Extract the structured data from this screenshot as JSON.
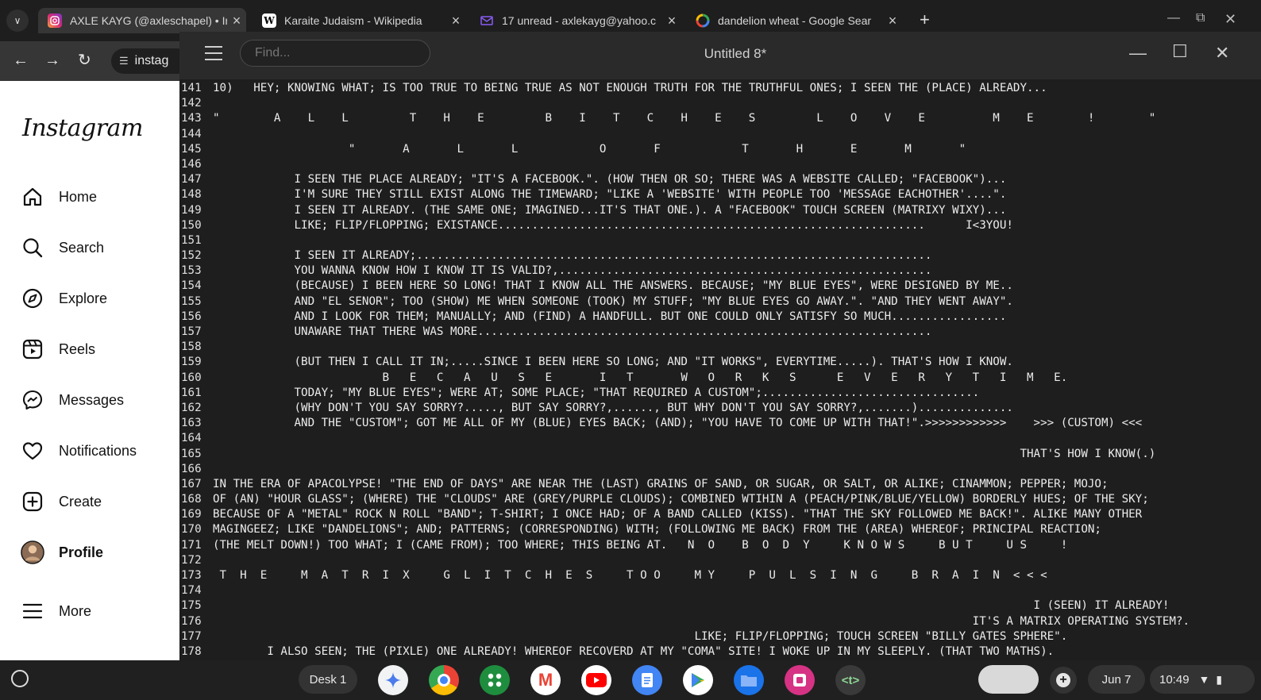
{
  "browser": {
    "tabs": [
      {
        "title": "AXLE KAYG (@axleschapel) • In",
        "icon": "instagram-icon",
        "active": true
      },
      {
        "title": "Karaite Judaism - Wikipedia",
        "icon": "wikipedia-icon",
        "active": false
      },
      {
        "title": "17 unread - axlekayg@yahoo.c",
        "icon": "mail-icon",
        "active": false
      },
      {
        "title": "dandelion wheat - Google Sear",
        "icon": "google-icon",
        "active": false
      }
    ],
    "omnibox_text": "instag"
  },
  "instagram": {
    "logo": "Instagram",
    "nav": [
      {
        "label": "Home",
        "icon": "home-icon"
      },
      {
        "label": "Search",
        "icon": "search-icon"
      },
      {
        "label": "Explore",
        "icon": "compass-icon"
      },
      {
        "label": "Reels",
        "icon": "reels-icon"
      },
      {
        "label": "Messages",
        "icon": "messenger-icon"
      },
      {
        "label": "Notifications",
        "icon": "heart-icon"
      },
      {
        "label": "Create",
        "icon": "plus-square-icon"
      },
      {
        "label": "Profile",
        "icon": "avatar"
      },
      {
        "label": "More",
        "icon": "hamburger-icon"
      }
    ]
  },
  "editor": {
    "title": "Untitled 8*",
    "find_placeholder": "Find...",
    "lines": [
      {
        "n": "141",
        "t": "10)   HEY; KNOWING WHAT; IS TOO TRUE TO BEING TRUE AS NOT ENOUGH TRUTH FOR THE TRUTHFUL ONES; I SEEN THE (PLACE) ALREADY..."
      },
      {
        "n": "142",
        "t": ""
      },
      {
        "n": "143",
        "t": "\"        A    L    L         T    H    E         B    I    T    C    H    E    S         L    O    V    E          M    E        !        \""
      },
      {
        "n": "144",
        "t": ""
      },
      {
        "n": "145",
        "t": "                    \"       A       L       L            O       F            T       H       E       M       \""
      },
      {
        "n": "146",
        "t": ""
      },
      {
        "n": "147",
        "t": "            I SEEN THE PLACE ALREADY; \"IT'S A FACEBOOK.\". (HOW THEN OR SO; THERE WAS A WEBSITE CALLED; \"FACEBOOK\")..."
      },
      {
        "n": "148",
        "t": "            I'M SURE THEY STILL EXIST ALONG THE TIMEWARD; \"LIKE A 'WEBSITE' WITH PEOPLE TOO 'MESSAGE EACHOTHER'....\"."
      },
      {
        "n": "149",
        "t": "            I SEEN IT ALREADY. (THE SAME ONE; IMAGINED...IT'S THAT ONE.). A \"FACEBOOK\" TOUCH SCREEN (MATRIXY WIXY)..."
      },
      {
        "n": "150",
        "t": "            LIKE; FLIP/FLOPPING; EXISTANCE...............................................................      I<3YOU!"
      },
      {
        "n": "151",
        "t": ""
      },
      {
        "n": "152",
        "t": "            I SEEN IT ALREADY;............................................................................"
      },
      {
        "n": "153",
        "t": "            YOU WANNA KNOW HOW I KNOW IT IS VALID?,......................................................."
      },
      {
        "n": "154",
        "t": "            (BECAUSE) I BEEN HERE SO LONG! THAT I KNOW ALL THE ANSWERS. BECAUSE; \"MY BLUE EYES\", WERE DESIGNED BY ME.."
      },
      {
        "n": "155",
        "t": "            AND \"EL SENOR\"; TOO (SHOW) ME WHEN SOMEONE (TOOK) MY STUFF; \"MY BLUE EYES GO AWAY.\". \"AND THEY WENT AWAY\"."
      },
      {
        "n": "156",
        "t": "            AND I LOOK FOR THEM; MANUALLY; AND (FIND) A HANDFULL. BUT ONE COULD ONLY SATISFY SO MUCH................."
      },
      {
        "n": "157",
        "t": "            UNAWARE THAT THERE WAS MORE..................................................................."
      },
      {
        "n": "158",
        "t": ""
      },
      {
        "n": "159",
        "t": "            (BUT THEN I CALL IT IN;.....SINCE I BEEN HERE SO LONG; AND \"IT WORKS\", EVERYTIME.....). THAT'S HOW I KNOW."
      },
      {
        "n": "160",
        "t": "                         B   E   C   A   U   S   E       I   T       W   O   R   K   S      E   V   E   R   Y   T   I   M   E."
      },
      {
        "n": "161",
        "t": "            TODAY; \"MY BLUE EYES\"; WERE AT; SOME PLACE; \"THAT REQUIRED A CUSTOM\";................................"
      },
      {
        "n": "162",
        "t": "            (WHY DON'T YOU SAY SORRY?....., BUT SAY SORRY?,......, BUT WHY DON'T YOU SAY SORRY?,.......).............."
      },
      {
        "n": "163",
        "t": "            AND THE \"CUSTOM\"; GOT ME ALL OF MY (BLUE) EYES BACK; (AND); \"YOU HAVE TO COME UP WITH THAT!\".>>>>>>>>>>>>    >>> (CUSTOM) <<<"
      },
      {
        "n": "164",
        "t": ""
      },
      {
        "n": "165",
        "t": "                                                                                                                       THAT'S HOW I KNOW(.)"
      },
      {
        "n": "166",
        "t": ""
      },
      {
        "n": "167",
        "t": "IN THE ERA OF APACOLYPSE! \"THE END OF DAYS\" ARE NEAR THE (LAST) GRAINS OF SAND, OR SUGAR, OR SALT, OR ALIKE; CINAMMON; PEPPER; MOJO;"
      },
      {
        "n": "168",
        "t": "OF (AN) \"HOUR GLASS\"; (WHERE) THE \"CLOUDS\" ARE (GREY/PURPLE CLOUDS); COMBINED WTIHIN A (PEACH/PINK/BLUE/YELLOW) BORDERLY HUES; OF THE SKY;"
      },
      {
        "n": "169",
        "t": "BECAUSE OF A \"METAL\" ROCK N ROLL \"BAND\"; T-SHIRT; I ONCE HAD; OF A BAND CALLED (KISS). \"THAT THE SKY FOLLOWED ME BACK!\". ALIKE MANY OTHER"
      },
      {
        "n": "170",
        "t": "MAGINGEEZ; LIKE \"DANDELIONS\"; AND; PATTERNS; (CORRESPONDING) WITH; (FOLLOWING ME BACK) FROM THE (AREA) WHEREOF; PRINCIPAL REACTION;"
      },
      {
        "n": "171",
        "t": "(THE MELT DOWN!) TOO WHAT; I (CAME FROM); TOO WHERE; THIS BEING AT.   N  O    B  O  D  Y     K N O W S     B U T     U S     !"
      },
      {
        "n": "172",
        "t": ""
      },
      {
        "n": "173",
        "t": " T  H  E     M  A  T  R  I  X     G  L  I  T  C  H  E  S     T O O     M Y     P  U  L  S  I  N  G     B  R  A  I  N  < < <"
      },
      {
        "n": "174",
        "t": ""
      },
      {
        "n": "175",
        "t": "                                                                                                                         I (SEEN) IT ALREADY!"
      },
      {
        "n": "176",
        "t": "                                                                                                                IT'S A MATRIX OPERATING SYSTEM?."
      },
      {
        "n": "177",
        "t": "                                                                       LIKE; FLIP/FLOPPING; TOUCH SCREEN \"BILLY GATES SPHERE\"."
      },
      {
        "n": "178",
        "t": "        I ALSO SEEN; THE (PIXLE) ONE ALREADY! WHEREOF RECOVERD AT MY \"COMA\" SITE! I WOKE UP IN MY SLEEPLY. (THAT TWO MATHS)."
      }
    ]
  },
  "shelf": {
    "desk_label": "Desk 1",
    "date": "Jun 7",
    "time": "10:49",
    "apps": [
      "gemini-icon",
      "chrome-icon",
      "app-grid-icon",
      "gmail-icon",
      "youtube-icon",
      "docs-icon",
      "play-store-icon",
      "files-icon",
      "photo-app-icon",
      "terminal-icon"
    ]
  }
}
